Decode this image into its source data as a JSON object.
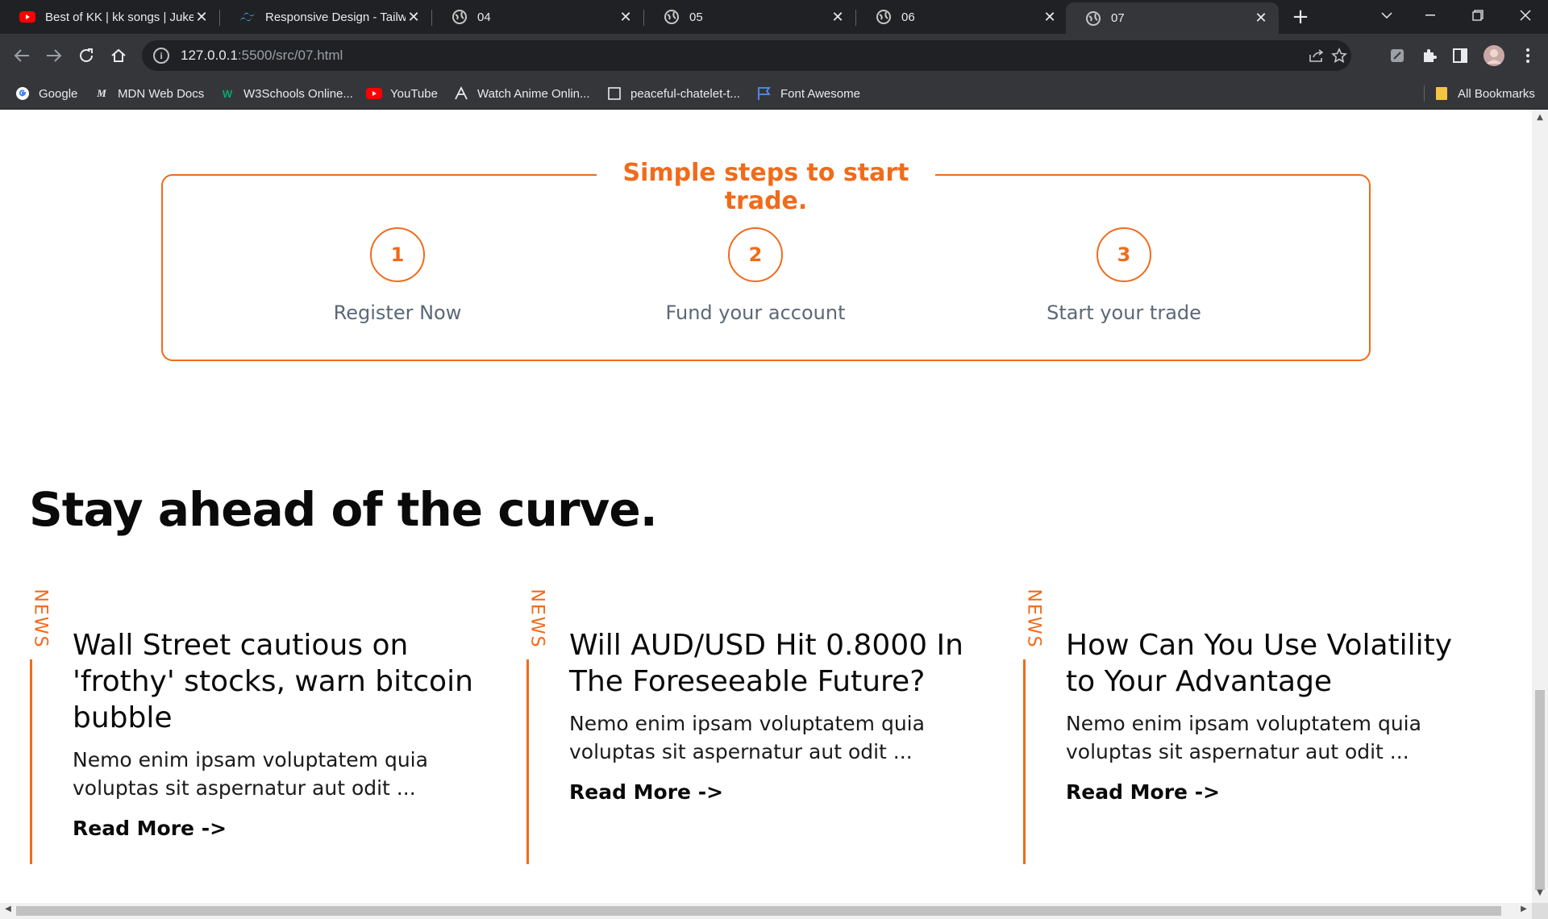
{
  "browser": {
    "tabs": [
      {
        "title": "Best of KK | kk songs | Juke",
        "icon": "youtube-icon"
      },
      {
        "title": "Responsive Design - Tailwi",
        "icon": "tailwind-icon"
      },
      {
        "title": "04",
        "icon": "globe-icon"
      },
      {
        "title": "05",
        "icon": "globe-icon"
      },
      {
        "title": "06",
        "icon": "globe-icon"
      },
      {
        "title": "07",
        "icon": "globe-icon",
        "active": true
      }
    ],
    "url": {
      "host": "127.0.0.1",
      "path": ":5500/src/07.html"
    },
    "bookmarks": [
      {
        "label": "Google",
        "icon": "google-icon"
      },
      {
        "label": "MDN Web Docs",
        "icon": "mdn-icon"
      },
      {
        "label": "W3Schools Online...",
        "icon": "w3schools-icon"
      },
      {
        "label": "YouTube",
        "icon": "youtube-icon"
      },
      {
        "label": "Watch Anime Onlin...",
        "icon": "anime-icon"
      },
      {
        "label": "peaceful-chatelet-t...",
        "icon": "page-icon"
      },
      {
        "label": "Font Awesome",
        "icon": "flag-icon"
      }
    ],
    "all_bookmarks": "All Bookmarks"
  },
  "steps": {
    "title": "Simple steps to start trade.",
    "items": [
      {
        "num": "1",
        "label": "Register Now"
      },
      {
        "num": "2",
        "label": "Fund your account"
      },
      {
        "num": "3",
        "label": "Start your trade"
      }
    ]
  },
  "news": {
    "headline": "Stay ahead of the curve.",
    "cards": [
      {
        "tag": "NEWS",
        "title": "Wall Street cautious on 'frothy' stocks, warn bitcoin bubble",
        "body": "Nemo enim ipsam voluptatem quia voluptas sit aspernatur aut odit ...",
        "more": "Read More ->"
      },
      {
        "tag": "NEWS",
        "title": "Will AUD/USD Hit 0.8000 In The Foreseeable Future?",
        "body": "Nemo enim ipsam voluptatem quia voluptas sit aspernatur aut odit ...",
        "more": "Read More ->"
      },
      {
        "tag": "NEWS",
        "title": "How Can You Use Volatility to Your Advantage",
        "body": "Nemo enim ipsam voluptatem quia voluptas sit aspernatur aut odit ...",
        "more": "Read More ->"
      }
    ]
  },
  "colors": {
    "accent": "#f06b1b",
    "step_label": "#5b6878",
    "chrome_dark": "#202124",
    "chrome_toolbar": "#35363a"
  }
}
